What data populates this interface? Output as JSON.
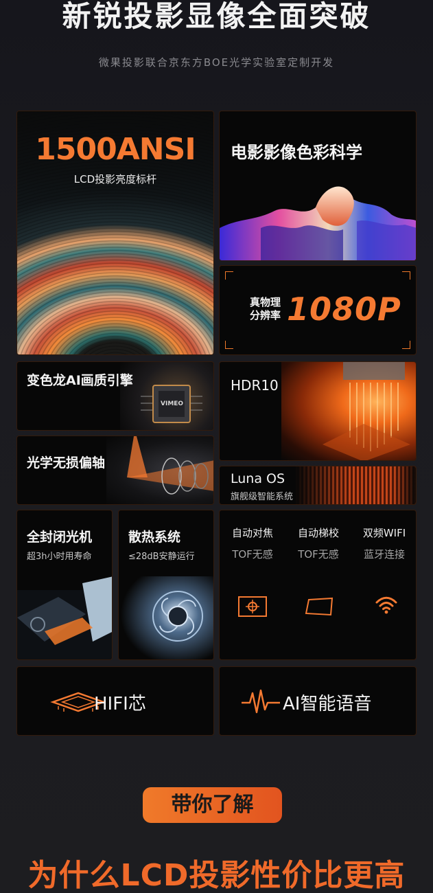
{
  "header": {
    "title": "新锐投影显像全面突破",
    "subtitle": "微果投影联合京东方BOE光学实验室定制开发"
  },
  "cards": {
    "ansi": {
      "value": "1500ANSI",
      "subtitle": "LCD投影亮度标杆"
    },
    "color_science": {
      "title": "电影影像色彩科学"
    },
    "resolution": {
      "label_line1": "真物理",
      "label_line2": "分辨率",
      "value": "1080P"
    },
    "ai_engine": {
      "title": "变色龙AI画质引擎",
      "chip_text": "VIMEO"
    },
    "hdr": {
      "title": "HDR10"
    },
    "optics": {
      "title": "光学无损偏轴"
    },
    "os": {
      "title": "Luna OS",
      "subtitle": "旗舰级智能系统"
    },
    "sealed": {
      "title": "全封闭光机",
      "subtitle": "超3h小时用寿命"
    },
    "cooling": {
      "title": "散热系统",
      "subtitle": "≤28dB安静运行"
    },
    "features": [
      {
        "title": "自动对焦",
        "subtitle": "TOF无感",
        "icon": "focus-icon"
      },
      {
        "title": "自动梯校",
        "subtitle": "TOF无感",
        "icon": "keystone-icon"
      },
      {
        "title": "双频WIFI",
        "subtitle": "蓝牙连接",
        "icon": "wifi-icon"
      }
    ],
    "hifi": {
      "title": "HIFI芯",
      "icon": "chip-icon"
    },
    "voice": {
      "title": "AI智能语音",
      "icon": "waveform-icon"
    }
  },
  "footer": {
    "pill_text": "带你了解",
    "headline": "为什么LCD投影性价比更高"
  },
  "colors": {
    "accent": "#f57a32",
    "background": "#1b1b20",
    "card": "#070707"
  }
}
